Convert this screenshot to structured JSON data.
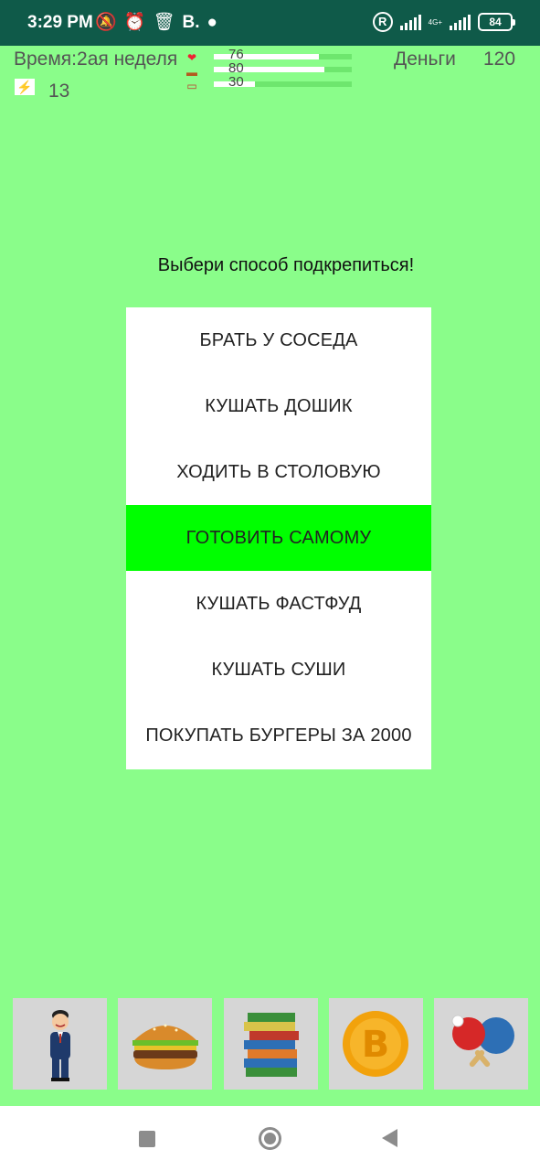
{
  "status_bar": {
    "time": "3:29 PM",
    "left_icons": [
      "muted-bell-icon",
      "alarm-icon",
      "trash-icon",
      "b-logo-icon",
      "notification-icon"
    ],
    "network": "4G+",
    "battery": "84"
  },
  "hud": {
    "time_label": "Время:2ая неделя",
    "stats": [
      {
        "icon": "heart-icon",
        "value": 76,
        "fill_fraction": 0.76
      },
      {
        "icon": "burger-icon",
        "value": 80,
        "fill_fraction": 0.8
      },
      {
        "icon": "book-icon",
        "value": 30,
        "fill_fraction": 0.3
      }
    ],
    "money_label": "Деньги",
    "money_value": "120",
    "energy_icon": "lightning-icon",
    "energy_value": "13"
  },
  "prompt": "Выбери способ подкрепиться!",
  "menu": {
    "items": [
      {
        "label": "БРАТЬ У СОСЕДА",
        "selected": false
      },
      {
        "label": "КУШАТЬ ДОШИК",
        "selected": false
      },
      {
        "label": "ХОДИТЬ В СТОЛОВУЮ",
        "selected": false
      },
      {
        "label": "ГОТОВИТЬ САМОМУ",
        "selected": true
      },
      {
        "label": "КУШАТЬ ФАСТФУД",
        "selected": false
      },
      {
        "label": "КУШАТЬ СУШИ",
        "selected": false
      },
      {
        "label": "ПОКУПАТЬ БУРГЕРЫ ЗА 2000",
        "selected": false
      }
    ]
  },
  "bottom_tiles": [
    {
      "icon": "man-in-suit-icon"
    },
    {
      "icon": "burger-icon"
    },
    {
      "icon": "books-icon"
    },
    {
      "icon": "bitcoin-icon"
    },
    {
      "icon": "ping-pong-icon"
    }
  ],
  "colors": {
    "background": "#8afd8a",
    "status_bar": "#0f5a49",
    "selected_item": "#00ff00",
    "tile_bg": "#d6d6d6"
  }
}
